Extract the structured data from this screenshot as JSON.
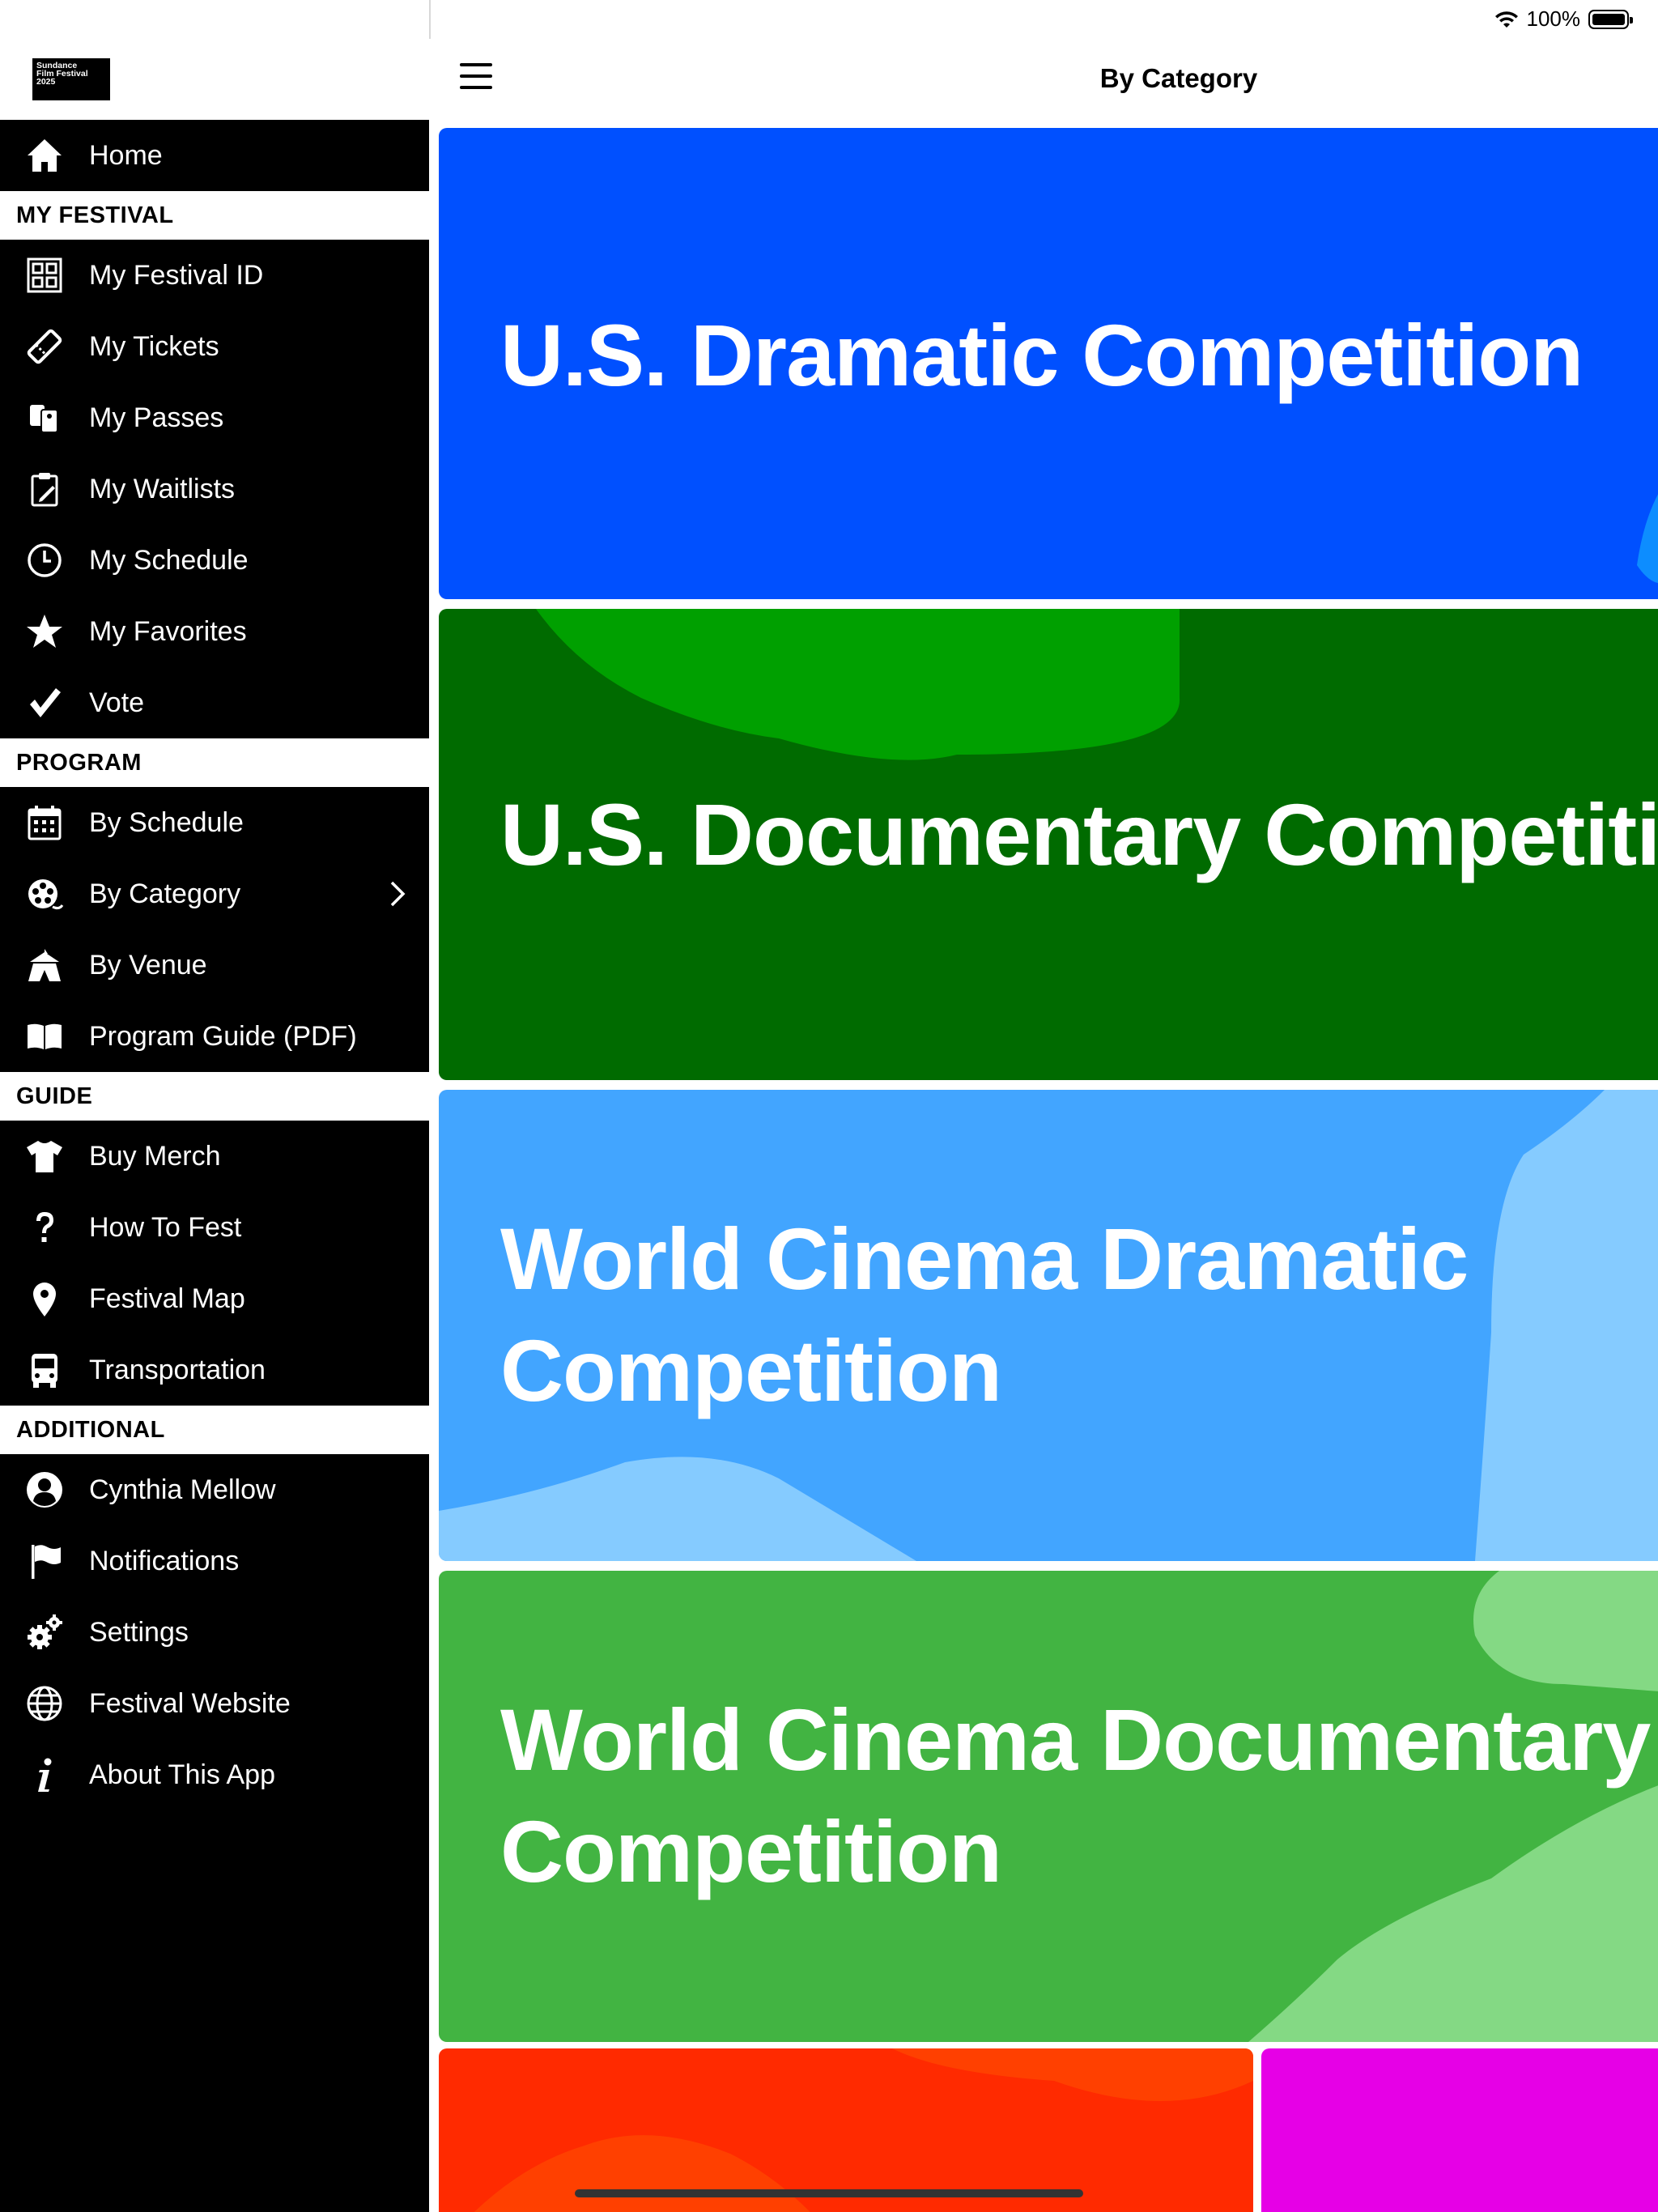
{
  "status_bar": {
    "battery_text": "100%"
  },
  "logo": {
    "line1": "Sundance",
    "line2": "Film Festival",
    "line3": "2025"
  },
  "top_nav": {
    "title": "By Category"
  },
  "sidebar": {
    "home": {
      "label": "Home"
    },
    "sections": [
      {
        "title": "MY FESTIVAL",
        "items": [
          {
            "label": "My Festival ID",
            "icon": "qr-code-icon"
          },
          {
            "label": "My Tickets",
            "icon": "ticket-icon"
          },
          {
            "label": "My Passes",
            "icon": "passes-icon"
          },
          {
            "label": "My Waitlists",
            "icon": "clipboard-icon"
          },
          {
            "label": "My Schedule",
            "icon": "clock-icon"
          },
          {
            "label": "My Favorites",
            "icon": "star-icon"
          },
          {
            "label": "Vote",
            "icon": "checkmark-icon"
          }
        ]
      },
      {
        "title": "PROGRAM",
        "items": [
          {
            "label": "By Schedule",
            "icon": "calendar-icon"
          },
          {
            "label": "By Category",
            "icon": "film-reel-icon"
          },
          {
            "label": "By Venue",
            "icon": "venue-tent-icon"
          },
          {
            "label": "Program Guide (PDF)",
            "icon": "book-icon"
          }
        ]
      },
      {
        "title": "GUIDE",
        "items": [
          {
            "label": "Buy Merch",
            "icon": "tshirt-icon"
          },
          {
            "label": "How To Fest",
            "icon": "question-icon"
          },
          {
            "label": "Festival Map",
            "icon": "map-pin-icon"
          },
          {
            "label": "Transportation",
            "icon": "bus-icon"
          }
        ]
      },
      {
        "title": "ADDITIONAL",
        "items": [
          {
            "label": "Cynthia Mellow",
            "icon": "user-avatar-icon"
          },
          {
            "label": "Notifications",
            "icon": "flag-icon"
          },
          {
            "label": "Settings",
            "icon": "gears-icon"
          },
          {
            "label": "Festival Website",
            "icon": "globe-icon"
          },
          {
            "label": "About This App",
            "icon": "info-icon"
          }
        ]
      }
    ]
  },
  "categories": [
    {
      "title_line1": "U.S. Dramatic Competition",
      "title_line2": "",
      "color": "#0050ff"
    },
    {
      "title_line1": "U.S. Documentary Competition",
      "title_line2": "",
      "color": "#006b00"
    },
    {
      "title_line1": "World Cinema Dramatic",
      "title_line2": "Competition",
      "color": "#42a5ff"
    },
    {
      "title_line1": "World Cinema Documentary",
      "title_line2": "Competition",
      "color": "#42b442"
    }
  ],
  "partial_cards": [
    {
      "color": "#ff2a00"
    },
    {
      "color": "#e600e6"
    }
  ]
}
